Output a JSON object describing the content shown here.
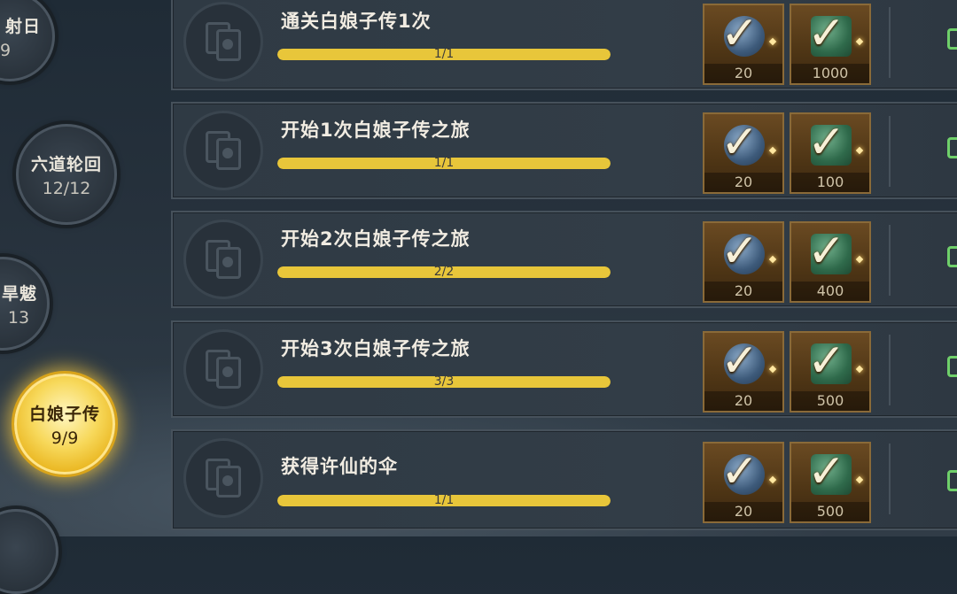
{
  "rail": {
    "nodes": [
      {
        "name": "射日",
        "progress": "9",
        "state": "partial"
      },
      {
        "name": "六道轮回",
        "progress": "12/12",
        "state": "normal"
      },
      {
        "name": "旱魃",
        "progress": "13",
        "state": "partial"
      },
      {
        "name": "白娘子传",
        "progress": "9/9",
        "state": "active"
      }
    ]
  },
  "tasks": [
    {
      "title": "通关白娘子传1次",
      "progress_text": "1/1",
      "progress": 1.0,
      "rewards": [
        {
          "icon": "blue-token-icon",
          "qty": "20"
        },
        {
          "icon": "green-token-icon",
          "qty": "1000"
        }
      ]
    },
    {
      "title": "开始1次白娘子传之旅",
      "progress_text": "1/1",
      "progress": 1.0,
      "rewards": [
        {
          "icon": "blue-token-icon",
          "qty": "20"
        },
        {
          "icon": "green-token-icon",
          "qty": "100"
        }
      ]
    },
    {
      "title": "开始2次白娘子传之旅",
      "progress_text": "2/2",
      "progress": 1.0,
      "rewards": [
        {
          "icon": "blue-token-icon",
          "qty": "20"
        },
        {
          "icon": "green-token-icon",
          "qty": "400"
        }
      ]
    },
    {
      "title": "开始3次白娘子传之旅",
      "progress_text": "3/3",
      "progress": 1.0,
      "rewards": [
        {
          "icon": "blue-token-icon",
          "qty": "20"
        },
        {
          "icon": "green-token-icon",
          "qty": "500"
        }
      ]
    },
    {
      "title": "获得许仙的伞",
      "progress_text": "1/1",
      "progress": 1.0,
      "rewards": [
        {
          "icon": "blue-token-icon",
          "qty": "20"
        },
        {
          "icon": "green-token-icon",
          "qty": "500"
        }
      ]
    }
  ],
  "colors": {
    "progress_fill": "#e8c63a",
    "active_node": "#f7d85a",
    "claimed_mark": "#6fd06a"
  }
}
